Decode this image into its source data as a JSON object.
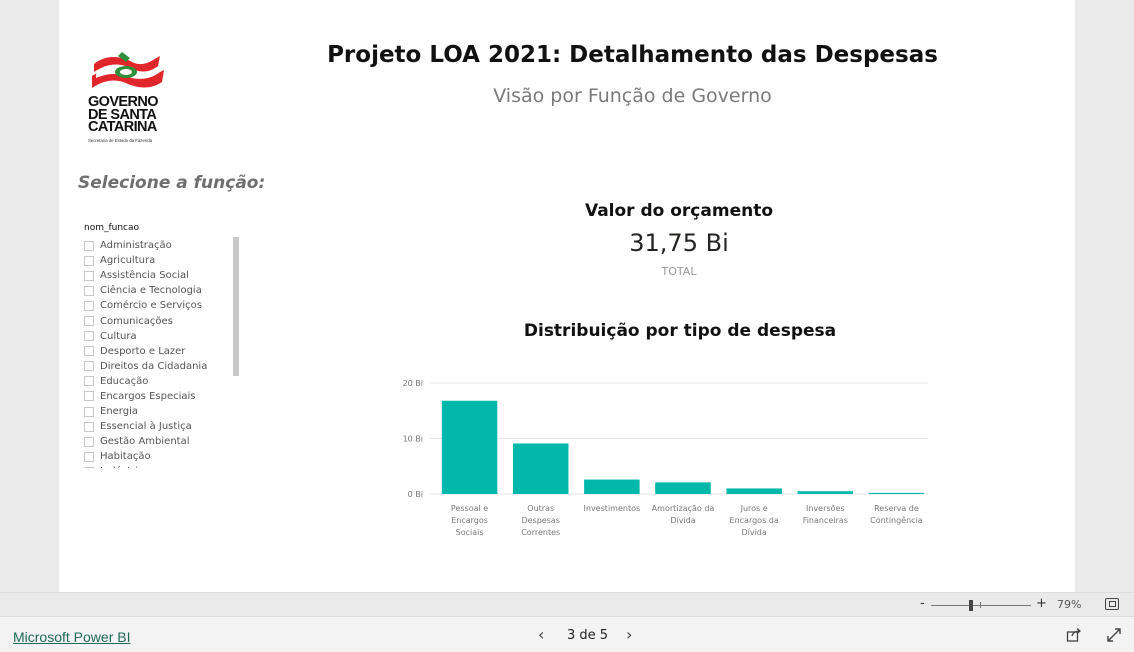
{
  "header": {
    "title": "Projeto LOA 2021: Detalhamento das Despesas",
    "subtitle": "Visão por Função de Governo"
  },
  "logo": {
    "line1": "GOVERNO",
    "line2": "DE SANTA",
    "line3": "CATARINA",
    "caption": "Secretaria de Estado da Fazenda"
  },
  "slicer": {
    "heading": "Selecione a função:",
    "field": "nom_funcao",
    "items": [
      "Administração",
      "Agricultura",
      "Assistência Social",
      "Ciência e Tecnologia",
      "Comércio e Serviços",
      "Comunicações",
      "Cultura",
      "Desporto e Lazer",
      "Direitos da Cidadania",
      "Educação",
      "Encargos Especiais",
      "Energia",
      "Essencial à Justiça",
      "Gestão Ambiental",
      "Habitação",
      "Indústria"
    ]
  },
  "card": {
    "title": "Valor do orçamento",
    "value": "31,75 Bi",
    "label": "TOTAL"
  },
  "chart_data": {
    "type": "bar",
    "title": "Distribuição por tipo de despesa",
    "categories": [
      "Pessoal e Encargos Sociais",
      "Outras Despesas Correntes",
      "Investimentos",
      "Amortização da Dívida",
      "Juros e Encargos da Dívida",
      "Inversões Financeiras",
      "Reserva de Contingência"
    ],
    "category_lines": [
      [
        "Pessoal e",
        "Encargos",
        "Sociais"
      ],
      [
        "Outras",
        "Despesas",
        "Correntes"
      ],
      [
        "Investimentos"
      ],
      [
        "Amortização da",
        "Dívida"
      ],
      [
        "Juros e",
        "Encargos da",
        "Dívida"
      ],
      [
        "Inversões",
        "Financeiras"
      ],
      [
        "Reserva de",
        "Contingência"
      ]
    ],
    "values": [
      16.8,
      9.1,
      2.6,
      2.1,
      1.0,
      0.5,
      0.2
    ],
    "ylim": [
      0,
      20
    ],
    "yticks": [
      0,
      10,
      20
    ],
    "ytick_labels": [
      "0 Bi",
      "10 Bi",
      "20 Bi"
    ],
    "grid": true,
    "color": "#01b8aa"
  },
  "footer": {
    "zoom_minus": "-",
    "zoom_plus": "+",
    "zoom": "79%",
    "zoom_level": 0.4,
    "brand": "Microsoft Power BI",
    "page": "3 de 5",
    "prev": "‹",
    "next": "›"
  },
  "colors": {
    "accent": "#01b8aa",
    "brand_link": "#1f6a56",
    "logo_red": "#e0262b",
    "logo_green": "#2f8f3a"
  }
}
